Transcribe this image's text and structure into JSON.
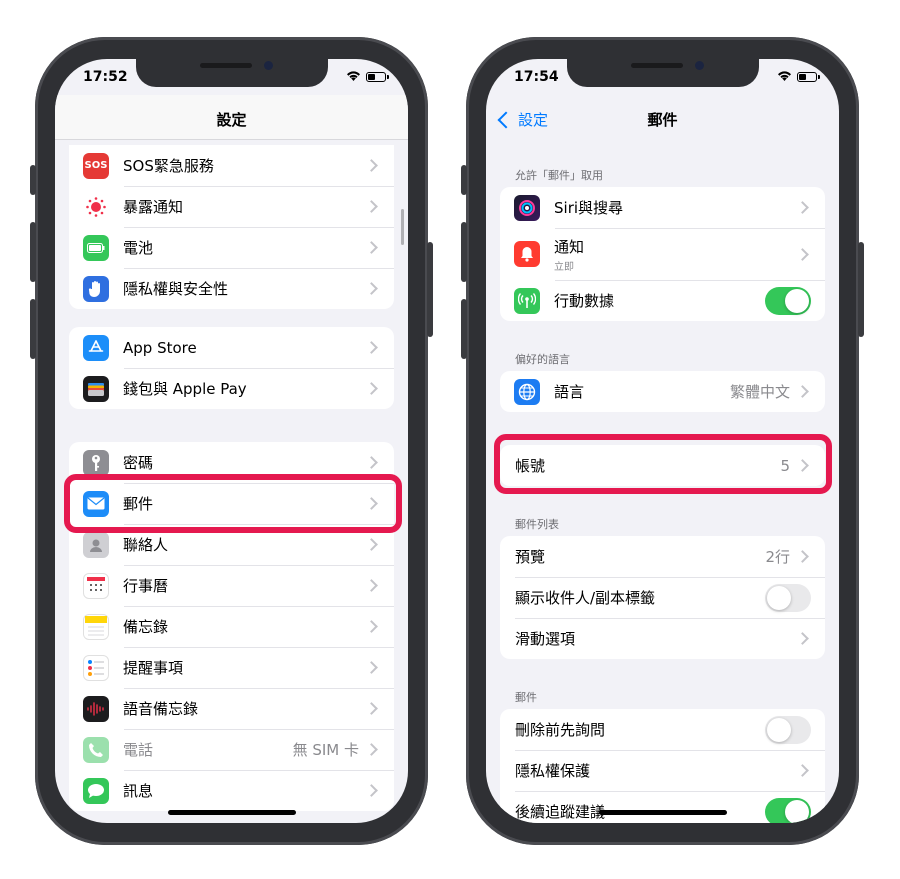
{
  "left_phone": {
    "time": "17:52",
    "nav_title": "設定",
    "groups": [
      [
        {
          "label": "SOS緊急服務",
          "icon": "sos-icon",
          "icon_text": "SOS",
          "color": "#e53935"
        },
        {
          "label": "暴露通知",
          "icon": "exposure-notification-icon",
          "color": "#ffffff"
        },
        {
          "label": "電池",
          "icon": "battery-icon",
          "color": "#34c759"
        },
        {
          "label": "隱私權與安全性",
          "icon": "hand-icon",
          "color": "#2f6fe0"
        }
      ],
      [
        {
          "label": "App Store",
          "icon": "app-store-icon",
          "color": "#1c8ef9"
        },
        {
          "label": "錢包與 Apple Pay",
          "icon": "wallet-icon",
          "color": "#1c1c1e"
        }
      ],
      [
        {
          "label": "密碼",
          "icon": "key-icon",
          "color": "#8e8e93"
        },
        {
          "label": "郵件",
          "icon": "mail-icon",
          "color": "#1d8cf8"
        },
        {
          "label": "聯絡人",
          "icon": "contacts-icon",
          "color": "#b8b8bd"
        },
        {
          "label": "行事曆",
          "icon": "calendar-icon",
          "color": "#ffffff"
        },
        {
          "label": "備忘錄",
          "icon": "notes-icon",
          "color": "#ffd60a"
        },
        {
          "label": "提醒事項",
          "icon": "reminders-icon",
          "color": "#ffffff"
        },
        {
          "label": "語音備忘錄",
          "icon": "voice-memos-icon",
          "color": "#1c1c1e"
        },
        {
          "label": "電話",
          "value": "無 SIM 卡",
          "icon": "phone-icon",
          "color": "#34c759",
          "dim": true
        },
        {
          "label": "訊息",
          "icon": "messages-icon",
          "color": "#34c759"
        }
      ]
    ]
  },
  "right_phone": {
    "time": "17:54",
    "back_label": "設定",
    "nav_title": "郵件",
    "sections": {
      "allow_header": "允許「郵件」取用",
      "siri_label": "Siri與搜尋",
      "notifications_label": "通知",
      "notifications_sub": "立即",
      "cellular_label": "行動數據",
      "cellular_on": true,
      "language_header": "偏好的語言",
      "language_label": "語言",
      "language_value": "繁體中文",
      "accounts_label": "帳號",
      "accounts_value": "5",
      "list_header": "郵件列表",
      "preview_label": "預覽",
      "preview_value": "2行",
      "show_to_cc_label": "顯示收件人/副本標籤",
      "show_to_cc_on": false,
      "swipe_label": "滑動選項",
      "mail_header": "郵件",
      "ask_delete_label": "刪除前先詢問",
      "ask_delete_on": false,
      "privacy_label": "隱私權保護",
      "followup_label": "後續追蹤建議",
      "followup_on": true
    }
  },
  "colors": {
    "highlight": "#e5194f",
    "toggle_on": "#34c759",
    "link": "#007aff"
  }
}
